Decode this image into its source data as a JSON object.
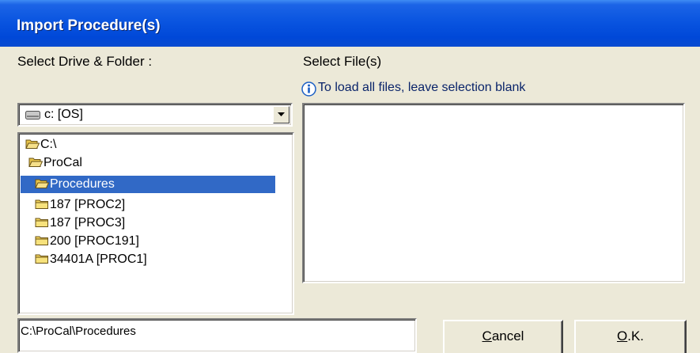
{
  "window": {
    "title": "Import Procedure(s)"
  },
  "left": {
    "label": "Select Drive & Folder :",
    "drive": {
      "value": "c: [OS]",
      "icon": "drive-icon"
    },
    "tree": [
      {
        "label": "C:\\",
        "icon": "open-folder-icon",
        "selected": false
      },
      {
        "label": "ProCal",
        "icon": "open-folder-icon",
        "selected": false
      },
      {
        "label": "Procedures",
        "icon": "open-folder-icon",
        "selected": true
      },
      {
        "label": "187 [PROC2]",
        "icon": "folder-icon",
        "selected": false
      },
      {
        "label": "187 [PROC3]",
        "icon": "folder-icon",
        "selected": false
      },
      {
        "label": "200 [PROC191]",
        "icon": "folder-icon",
        "selected": false
      },
      {
        "label": "34401A [PROC1]",
        "icon": "folder-icon",
        "selected": false
      }
    ],
    "path": "C:\\ProCal\\Procedures"
  },
  "right": {
    "label": "Select File(s)",
    "info": "To load all files, leave selection blank",
    "info_icon": "info-icon",
    "files": []
  },
  "buttons": {
    "cancel_accel": "C",
    "cancel_rest": "ancel",
    "ok_accel": "O",
    "ok_rest": ".K."
  },
  "colors": {
    "title_bar": "#0A55E0",
    "selection": "#3169C6",
    "dialog_bg": "#ECE9D8"
  }
}
